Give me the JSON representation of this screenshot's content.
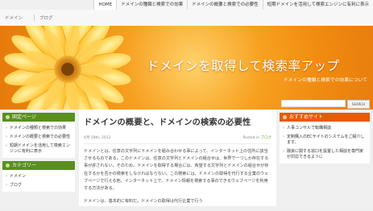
{
  "top_nav": [
    "HOME",
    "ドメインの種類と検索での効果",
    "ドメインの概要と検索での必要性",
    "短期ドメインを活用して検索エンジンに有利に表示"
  ],
  "sub_nav": [
    "ドメイン",
    "ブログ"
  ],
  "banner": {
    "title": "ドメインを取得して検索率アップ",
    "subtitle": "ドメインの種類と検索での効果について",
    "search_button": "SEARCH"
  },
  "left": {
    "sections": [
      {
        "title": "固定ページ",
        "items": [
          "ドメインの種類と検索での効果",
          "ドメインの概要と検索での必要性",
          "短期ドメインを活用して検索エンジンに有利に表示"
        ]
      },
      {
        "title": "カテゴリー",
        "items": [
          "ドメイン",
          "ブログ"
        ]
      }
    ]
  },
  "article": {
    "title": "ドメインの概要と、ドメインの検索の必要性",
    "date": "4月 18th, 2012",
    "posted_prefix": "Posted in",
    "category": "ブログ",
    "paragraphs": [
      "ドメインとは、任意の文字列にドメインを組み合わせる事によって、インターネット上の住所に該当させるものである。このドメインは、任意の文字列とドメインの組合せは、世界で一つしか存在する事が許されない。そのため、ドメインを取得する場合には、希望する文字列とドメインの組合せが存在するかを否かの検索をしなければならない。この検索には、ドメインの取得を代行する企業のウェブページで行える他、インターネット上で、ドメイン情報を検索する事のできるウェブページを利用する方法がある。",
      "ドメインは、基本的に有料だ。ドメインの取得は代行企業で行う"
    ]
  },
  "right": {
    "title": "おすすめサイト",
    "items": [
      "人事コンサルで転職相談",
      "定制購入のECサイトのシステムをご紹介します。",
      "融資に関する窓口を設置した相談を専門家が対応できるように"
    ]
  }
}
